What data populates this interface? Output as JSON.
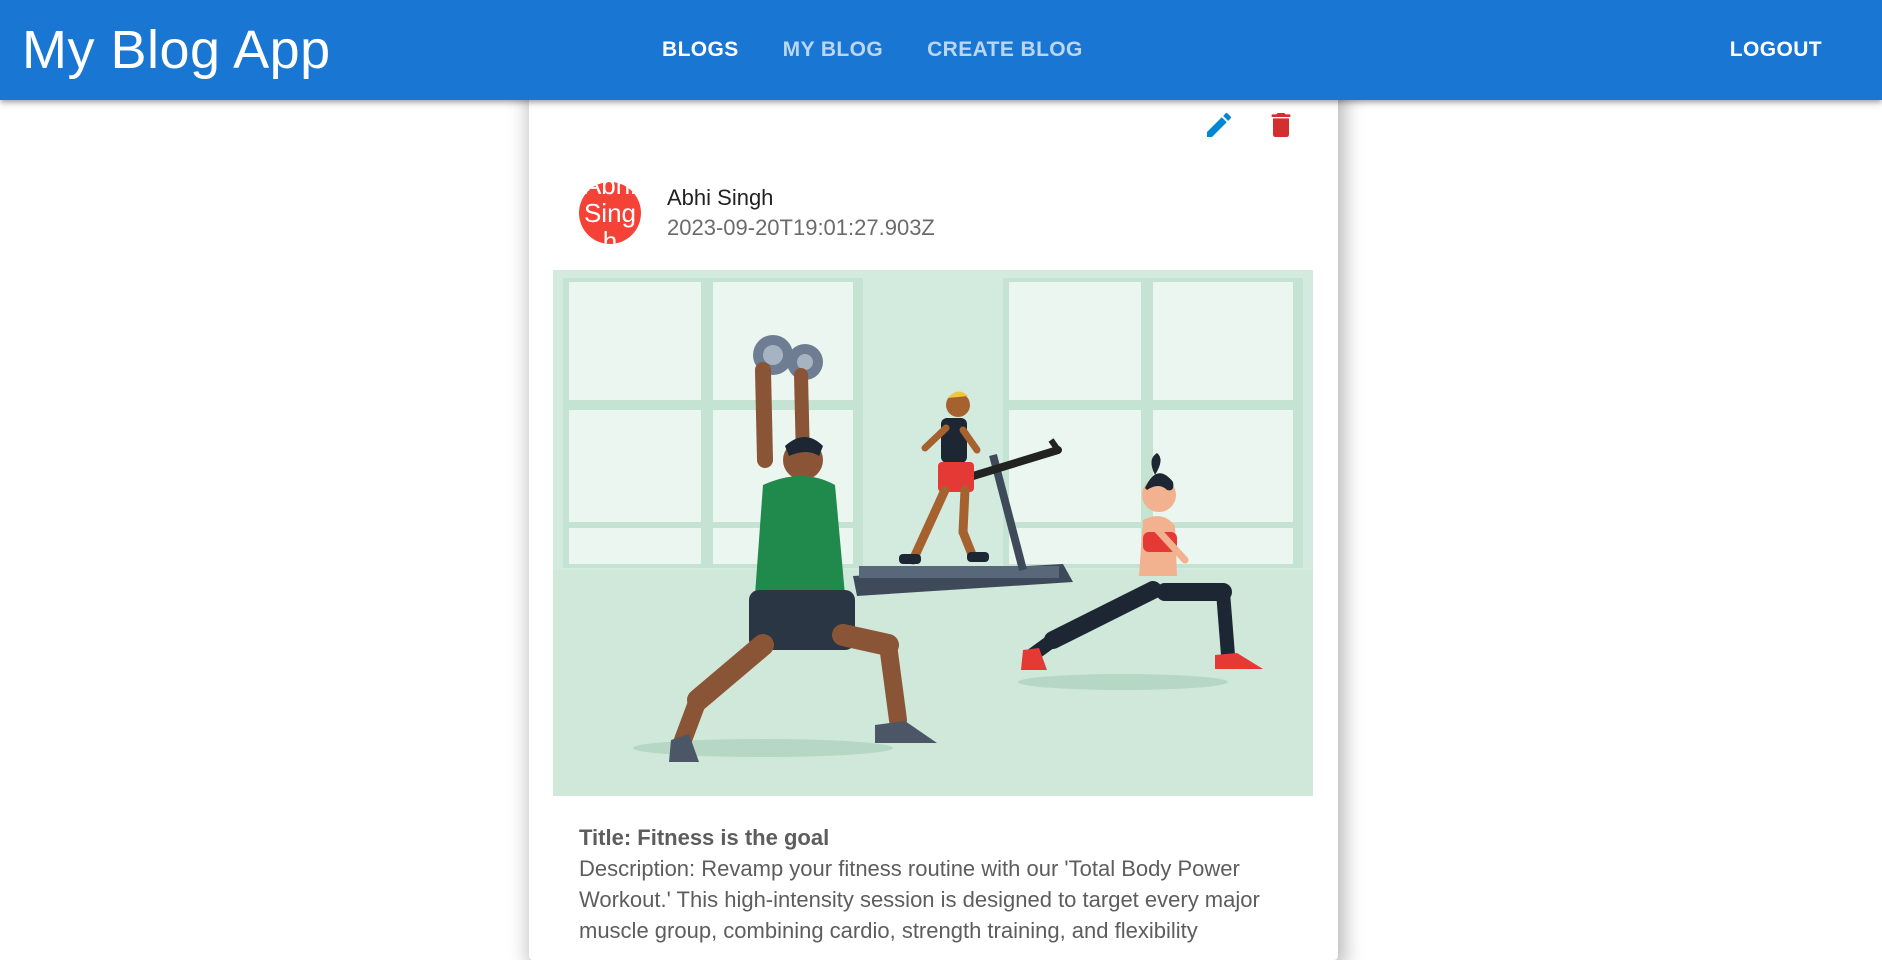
{
  "app": {
    "title": "My Blog App"
  },
  "nav": {
    "tabs": [
      {
        "label": "BLOGS",
        "active": true
      },
      {
        "label": "MY BLOG",
        "active": false
      },
      {
        "label": "CREATE BLOG",
        "active": false
      }
    ],
    "logout_label": "LOGOUT"
  },
  "colors": {
    "appbar": "#1976d2",
    "edit_icon": "#0288d1",
    "delete_icon": "#d32f2f",
    "avatar": "#f44336"
  },
  "post": {
    "avatar_text": "Abhi Singh",
    "author": "Abhi Singh",
    "date": "2023-09-20T19:01:27.903Z",
    "image_icon": "gym-illustration",
    "title_line": "Title: Fitness is the goal",
    "description": "Description: Revamp your fitness routine with our 'Total Body Power Workout.' This high-intensity session is designed to target every major muscle group, combining cardio, strength training, and flexibility"
  },
  "icons": {
    "edit": "pencil-icon",
    "delete": "trash-icon"
  }
}
